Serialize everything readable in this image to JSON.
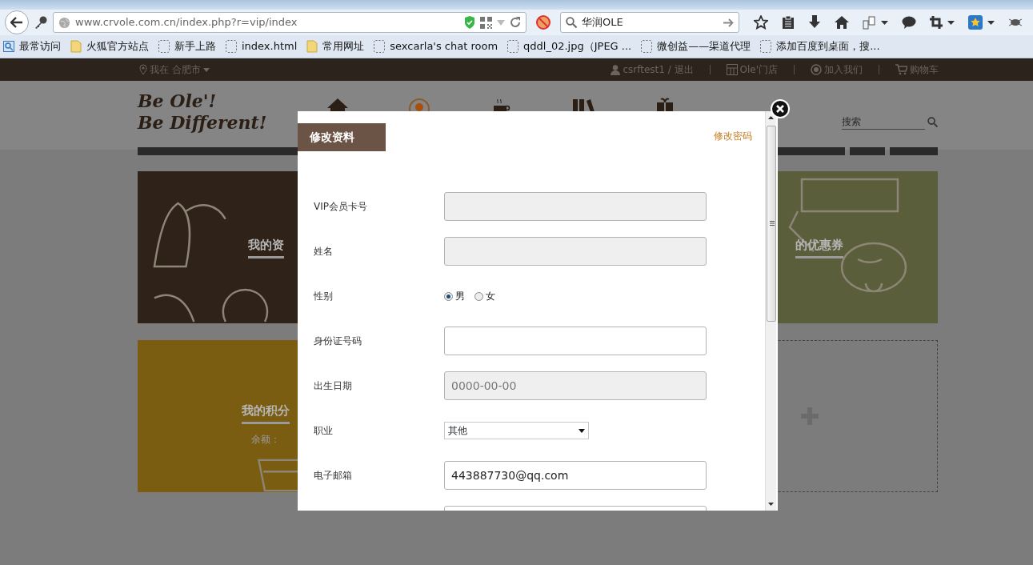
{
  "browser": {
    "url": "www.crvole.com.cn/index.php?r=vip/index",
    "search": "华润OLE",
    "bookmarks": [
      {
        "label": "最常访问",
        "kind": "special"
      },
      {
        "label": "火狐官方站点",
        "kind": "folder"
      },
      {
        "label": "新手上路",
        "kind": "page"
      },
      {
        "label": "index.html",
        "kind": "page"
      },
      {
        "label": "常用网址",
        "kind": "folder"
      },
      {
        "label": "sexcarla's chat room",
        "kind": "page"
      },
      {
        "label": "qddl_02.jpg（JPEG ...",
        "kind": "page"
      },
      {
        "label": "微创益——渠道代理",
        "kind": "page"
      },
      {
        "label": "添加百度到桌面，搜...",
        "kind": "page"
      }
    ]
  },
  "site": {
    "location": "我在 合肥市",
    "user": "csrftest1 / 退出",
    "links": [
      {
        "label": "Ole'门店",
        "kind": "store"
      },
      {
        "label": "加入我们",
        "kind": "join"
      },
      {
        "label": "购物车",
        "kind": "cart"
      }
    ],
    "logo": [
      "Be Ole'!",
      "Be Different!"
    ],
    "search_placeholder": "搜索"
  },
  "cards": [
    {
      "title": "我的资",
      "kind": "profile",
      "color": "#2e2219"
    },
    {
      "title": "的优惠券",
      "kind": "coupon",
      "color": "#5a5e3a"
    },
    {
      "title": "我的积分",
      "subtitle": "余额：",
      "kind": "points",
      "color": "#7b5d12"
    },
    {
      "kind": "add"
    }
  ],
  "modal": {
    "title": "修改资料",
    "link": "修改密码",
    "fields": [
      {
        "label": "VIP会员卡号",
        "kind": "text",
        "disabled": true
      },
      {
        "label": "姓名",
        "kind": "text",
        "disabled": true
      },
      {
        "label": "性别",
        "kind": "radio",
        "options": [
          {
            "label": "男",
            "selected": true
          },
          {
            "label": "女",
            "selected": false
          }
        ]
      },
      {
        "label": "身份证号码",
        "kind": "text",
        "disabled": false
      },
      {
        "label": "出生日期",
        "kind": "text",
        "disabled": true,
        "placeholder": "0000-00-00"
      },
      {
        "label": "职业",
        "kind": "select",
        "value": "其他"
      },
      {
        "label": "电子邮箱",
        "kind": "text",
        "disabled": false,
        "value": "443887730@qq.com"
      },
      {
        "kind": "text",
        "disabled": false
      }
    ]
  }
}
